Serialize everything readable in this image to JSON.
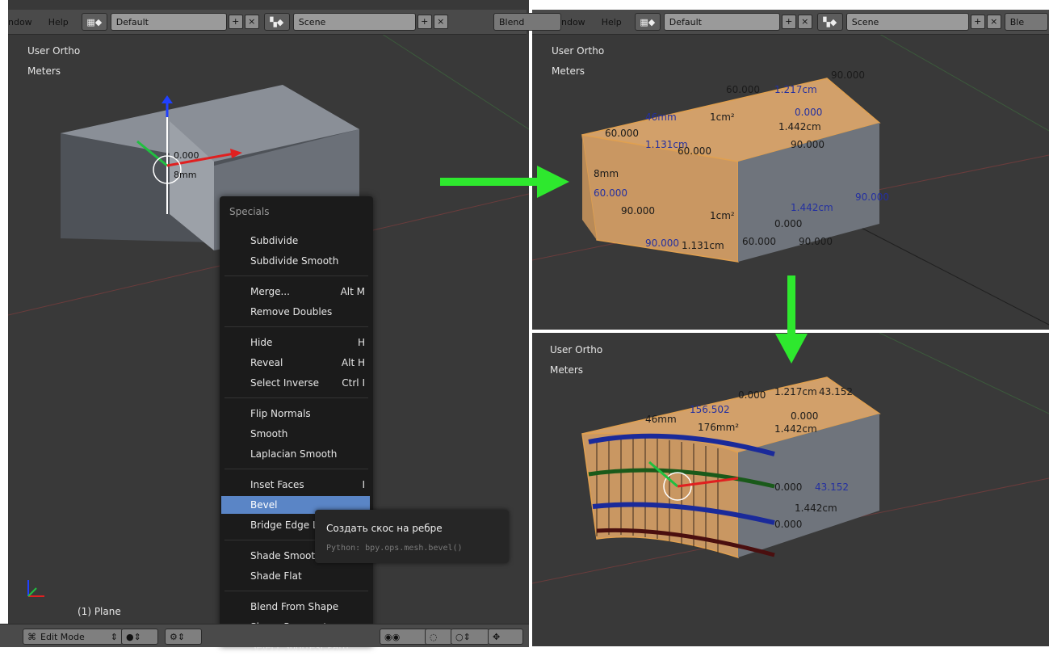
{
  "header_left": {
    "menu_window": "ndow",
    "menu_help": "Help",
    "layout": "Default",
    "scene": "Scene"
  },
  "header_right": {
    "engine_label": "Blend",
    "menu_window": "ndow",
    "menu_help": "Help",
    "layout": "Default",
    "scene": "Scene",
    "cut_label": "Ble"
  },
  "viewport_left": {
    "view_name": "User Ortho",
    "units": "Meters",
    "object_label": "(1) Plane",
    "overlay_vals": [
      "0.000",
      "8mm"
    ]
  },
  "viewport_top_right": {
    "view_name": "User Ortho",
    "units": "Meters",
    "overlay": [
      "1.217cm",
      "90.000",
      "60.000",
      "0.000",
      "1.442cm",
      "90.000",
      "46mm",
      "1cm²",
      "60.000",
      "1.131cm",
      "60.000",
      "8mm",
      "60.000",
      "90.000",
      "1cm²",
      "1.442cm",
      "0.000",
      "90.000",
      "90.000",
      "1.131cm",
      "60.000",
      "90.000"
    ]
  },
  "viewport_bottom_right": {
    "view_name": "User Ortho",
    "units": "Meters",
    "overlay": [
      "0.000",
      "1.217cm",
      "43.152",
      "156.502",
      "46mm",
      "176mm²",
      "0.000",
      "1.442cm",
      "0.000",
      "43.152",
      "1.442cm",
      "0.000"
    ]
  },
  "specials_menu": {
    "title": "Specials",
    "groups": [
      [
        {
          "label": "Subdivide",
          "shortcut": ""
        },
        {
          "label": "Subdivide Smooth",
          "shortcut": ""
        }
      ],
      [
        {
          "label": "Merge...",
          "shortcut": "Alt M"
        },
        {
          "label": "Remove Doubles",
          "shortcut": ""
        }
      ],
      [
        {
          "label": "Hide",
          "shortcut": "H"
        },
        {
          "label": "Reveal",
          "shortcut": "Alt H"
        },
        {
          "label": "Select Inverse",
          "shortcut": "Ctrl I"
        }
      ],
      [
        {
          "label": "Flip Normals",
          "shortcut": ""
        },
        {
          "label": "Smooth",
          "shortcut": ""
        },
        {
          "label": "Laplacian Smooth",
          "shortcut": ""
        }
      ],
      [
        {
          "label": "Inset Faces",
          "shortcut": "I"
        },
        {
          "label": "Bevel",
          "shortcut": ""
        },
        {
          "label": "Bridge Edge Loops",
          "shortcut": ""
        }
      ],
      [
        {
          "label": "Shade Smooth",
          "shortcut": ""
        },
        {
          "label": "Shade Flat",
          "shortcut": ""
        }
      ],
      [
        {
          "label": "Blend From Shape",
          "shortcut": ""
        },
        {
          "label": "Shape Propagate",
          "shortcut": ""
        },
        {
          "label": "Select Shortest Path",
          "shortcut": ""
        }
      ]
    ],
    "selected": "Bevel"
  },
  "tooltip": {
    "title": "Создать скос на ребре",
    "python": "Python: bpy.ops.mesh.bevel()"
  },
  "footer": {
    "mode": "Edit Mode"
  },
  "colors": {
    "viewport_bg": "#393939",
    "selected_menu": "#5a85c6",
    "arrow_green": "#2ee82e",
    "face_select": "#d2a06a"
  }
}
